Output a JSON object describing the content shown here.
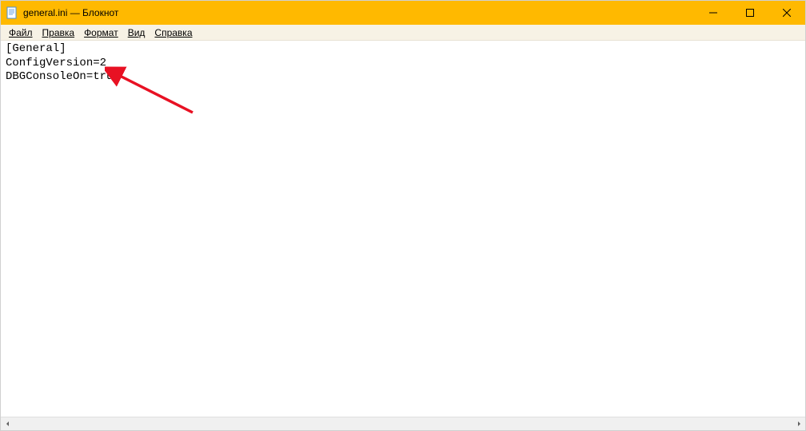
{
  "titlebar": {
    "title": "general.ini — Блокнот"
  },
  "menu": {
    "file": "Файл",
    "edit": "Правка",
    "format": "Формат",
    "view": "Вид",
    "help": "Справка"
  },
  "editor": {
    "line1": "[General]",
    "line2": "ConfigVersion=2",
    "line3": "DBGConsoleOn=true"
  }
}
